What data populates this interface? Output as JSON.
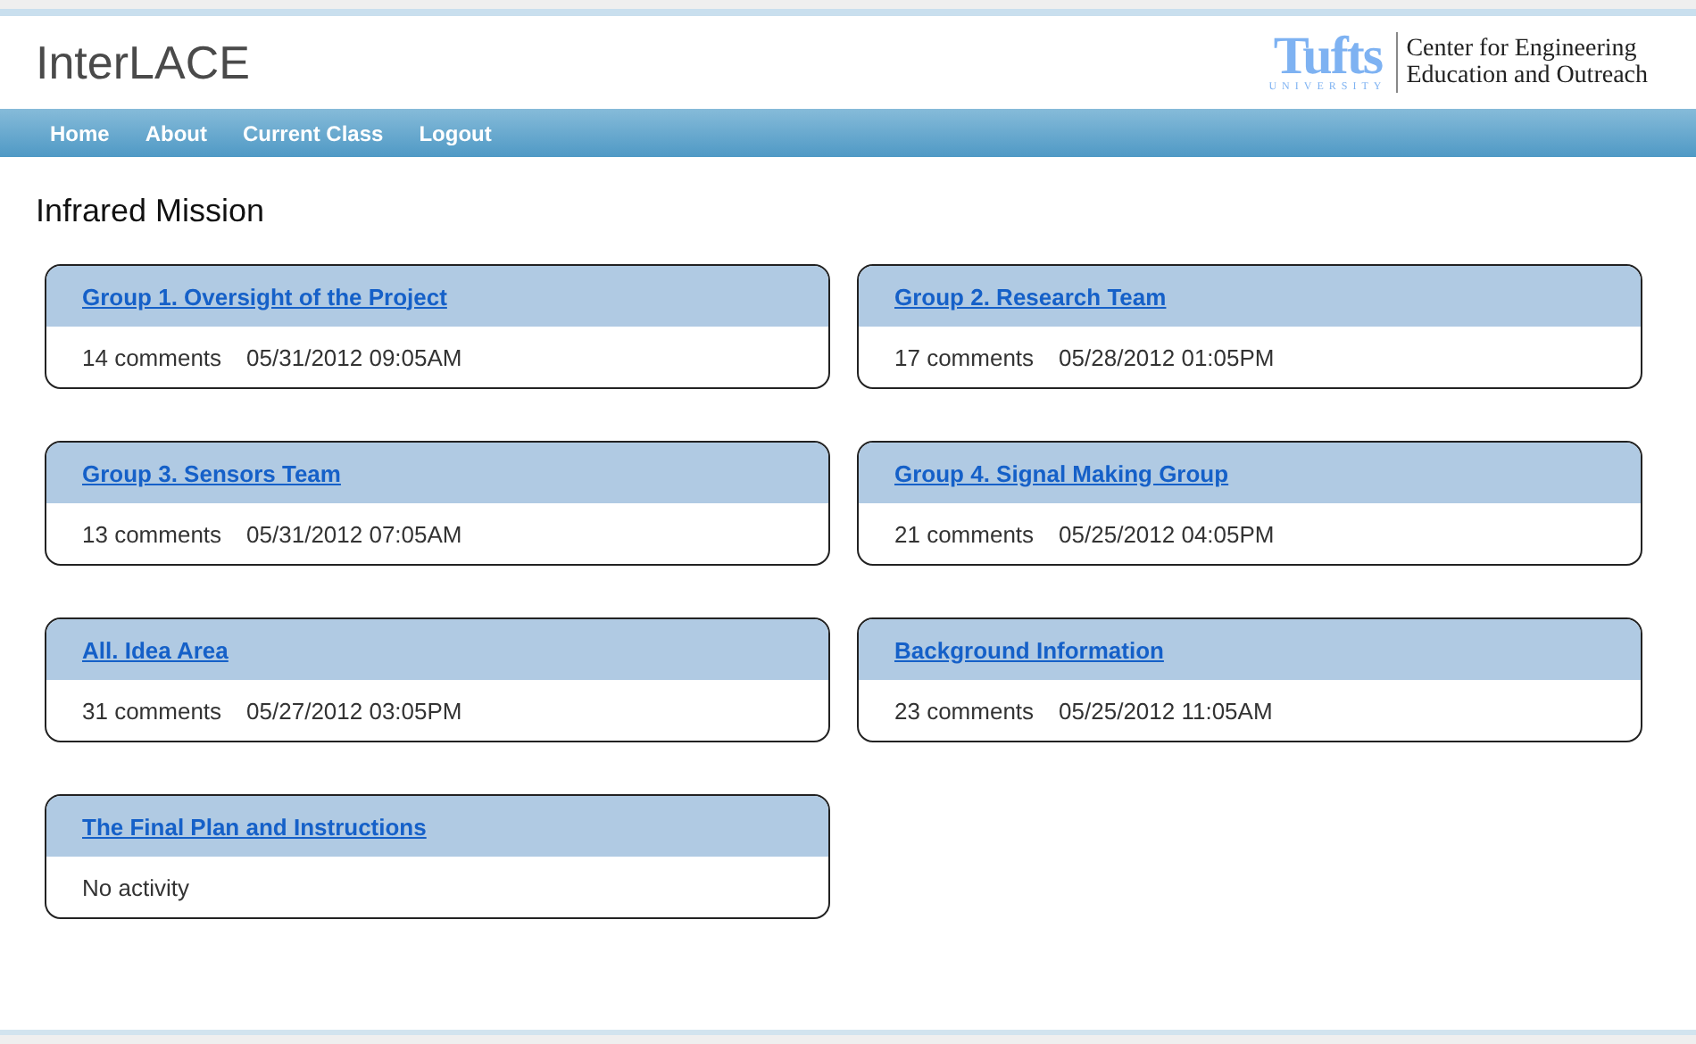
{
  "site_title": "InterLACE",
  "logo": {
    "wordmark": "Tufts",
    "subtitle": "UNIVERSITY",
    "lines": [
      "Center for Engineering",
      "Education and Outreach"
    ]
  },
  "nav": [
    "Home",
    "About",
    "Current Class",
    "Logout"
  ],
  "page_title": "Infrared Mission",
  "forums": [
    {
      "title": "Group 1. Oversight of the Project",
      "kind": "activity",
      "comments": "14 comments",
      "date": "05/31/2012 09:05AM"
    },
    {
      "title": "Group 2. Research Team",
      "kind": "activity",
      "comments": "17 comments",
      "date": "05/28/2012 01:05PM"
    },
    {
      "title": "Group 3. Sensors Team",
      "kind": "activity",
      "comments": "13 comments",
      "date": "05/31/2012 07:05AM"
    },
    {
      "title": "Group 4. Signal Making Group",
      "kind": "activity",
      "comments": "21 comments",
      "date": "05/25/2012 04:05PM"
    },
    {
      "title": "All. Idea Area",
      "kind": "activity",
      "comments": "31 comments",
      "date": "05/27/2012 03:05PM"
    },
    {
      "title": "Background Information",
      "kind": "activity",
      "comments": "23 comments",
      "date": "05/25/2012 11:05AM"
    },
    {
      "title": "The Final Plan and Instructions",
      "kind": "empty",
      "note": "No activity"
    }
  ]
}
